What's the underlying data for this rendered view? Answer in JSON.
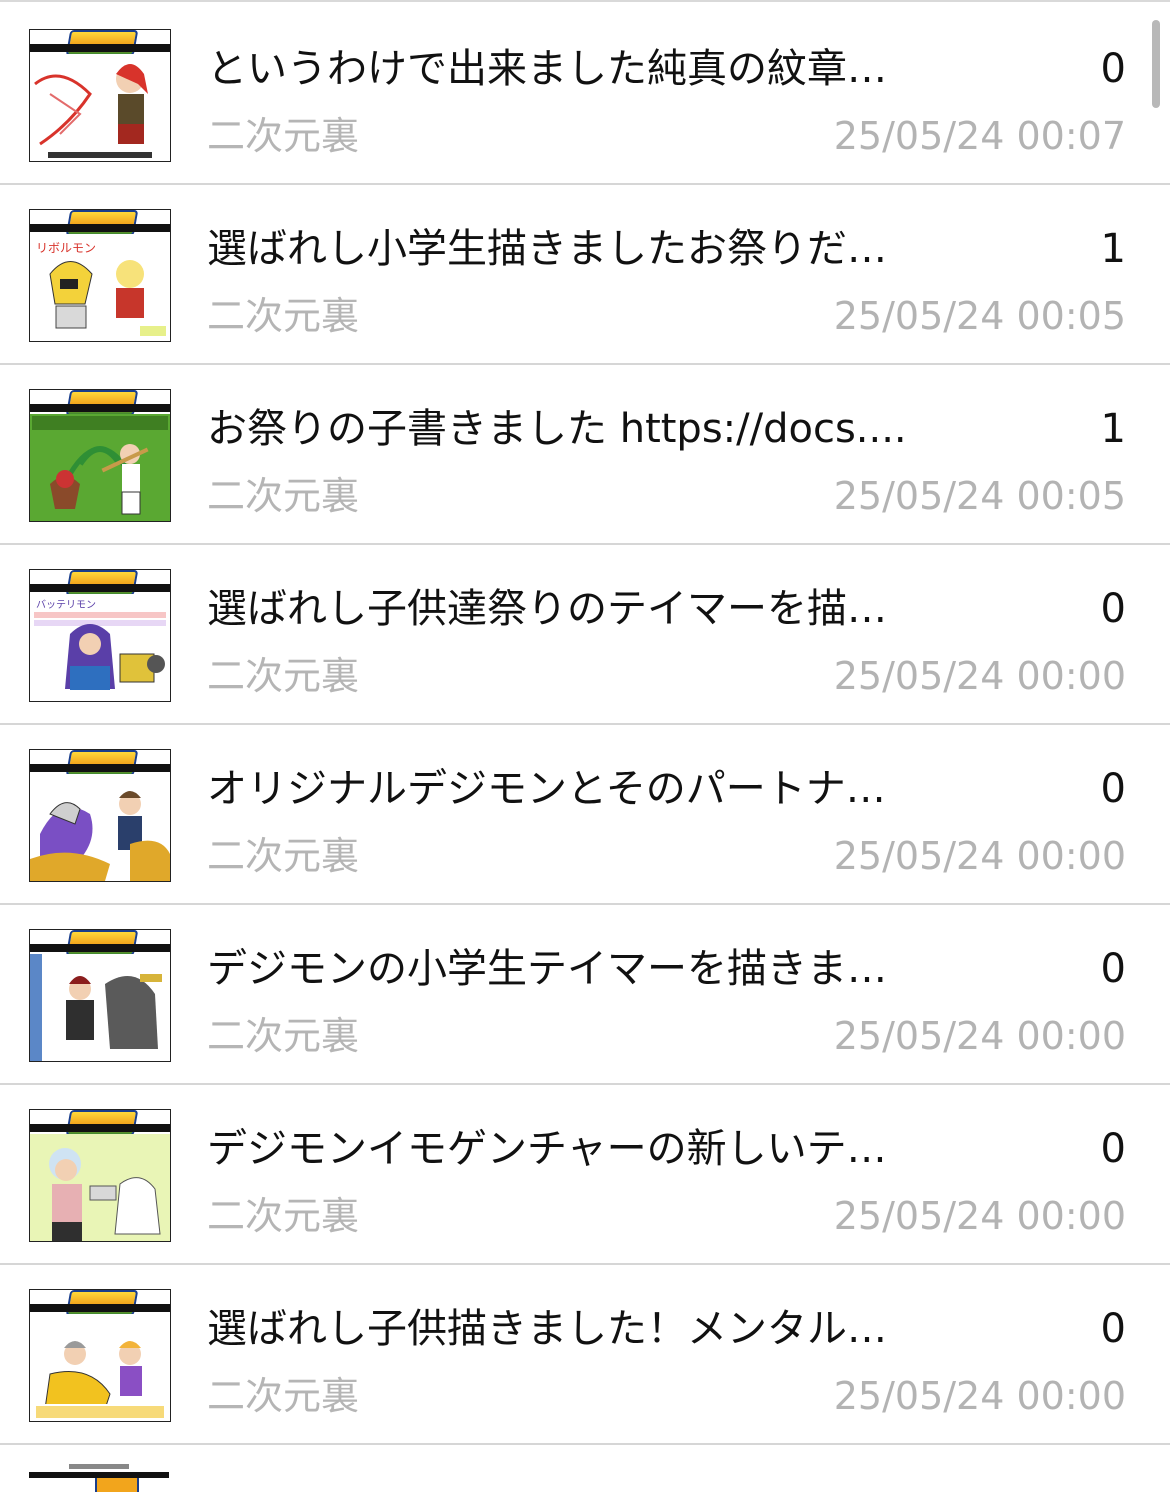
{
  "threads": [
    {
      "title": "というわけで出来ました純真の紋章…",
      "count": "0",
      "board": "二次元裏",
      "date": "25/05/24 00:07",
      "thumb_bg": "#ffffff",
      "thumb_accent": "#d8332b"
    },
    {
      "title": "選ばれし小学生描きましたお祭りだ…",
      "count": "1",
      "board": "二次元裏",
      "date": "25/05/24 00:05",
      "thumb_bg": "#ffffff",
      "thumb_accent": "#f3d23a"
    },
    {
      "title": "お祭りの子書きました https://docs....",
      "count": "1",
      "board": "二次元裏",
      "date": "25/05/24 00:05",
      "thumb_bg": "#5aa832",
      "thumb_accent": "#8a4a2a"
    },
    {
      "title": "選ばれし子供達祭りのテイマーを描…",
      "count": "0",
      "board": "二次元裏",
      "date": "25/05/24 00:00",
      "thumb_bg": "#ffffff",
      "thumb_accent": "#5a3fa8"
    },
    {
      "title": "オリジナルデジモンとそのパートナ…",
      "count": "0",
      "board": "二次元裏",
      "date": "25/05/24 00:00",
      "thumb_bg": "#ffffff",
      "thumb_accent": "#e0a82a"
    },
    {
      "title": "デジモンの小学生テイマーを描きま…",
      "count": "0",
      "board": "二次元裏",
      "date": "25/05/24 00:00",
      "thumb_bg": "#ffffff",
      "thumb_accent": "#4a4a4a"
    },
    {
      "title": "デジモンイモゲンチャーの新しいテ…",
      "count": "0",
      "board": "二次元裏",
      "date": "25/05/24 00:00",
      "thumb_bg": "#e9f5b6",
      "thumb_accent": "#8fb3cf"
    },
    {
      "title": "選ばれし子供描きました！メンタル…",
      "count": "0",
      "board": "二次元裏",
      "date": "25/05/24 00:00",
      "thumb_bg": "#ffffff",
      "thumb_accent": "#f2c21f"
    }
  ],
  "colors": {
    "title": "#111111",
    "meta": "#b5b5b5",
    "divider": "#d6d6d6",
    "scrollbar": "#b8b8b8"
  }
}
